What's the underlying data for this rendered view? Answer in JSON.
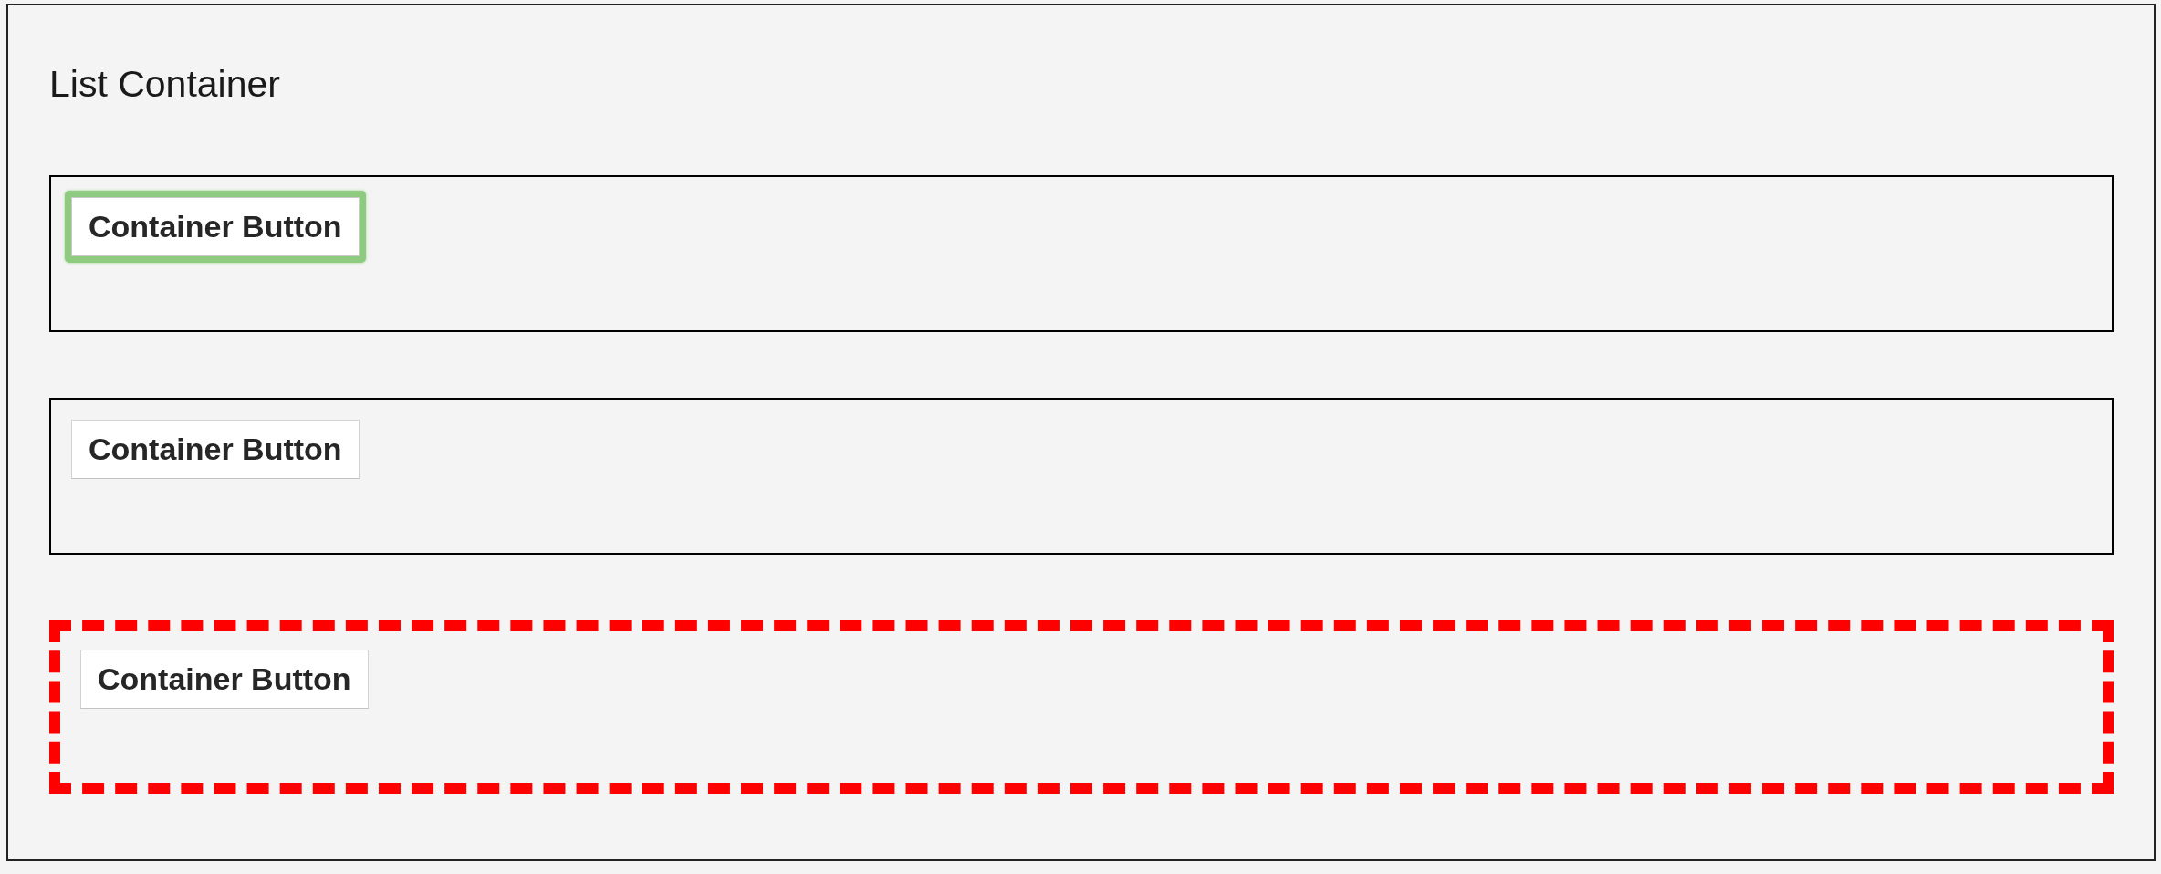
{
  "panel": {
    "title": "List Container"
  },
  "containers": [
    {
      "highlighted": false,
      "button": {
        "label": "Container Button",
        "focused": true
      }
    },
    {
      "highlighted": false,
      "button": {
        "label": "Container Button",
        "focused": false
      }
    },
    {
      "highlighted": true,
      "button": {
        "label": "Container Button",
        "focused": false
      }
    }
  ]
}
